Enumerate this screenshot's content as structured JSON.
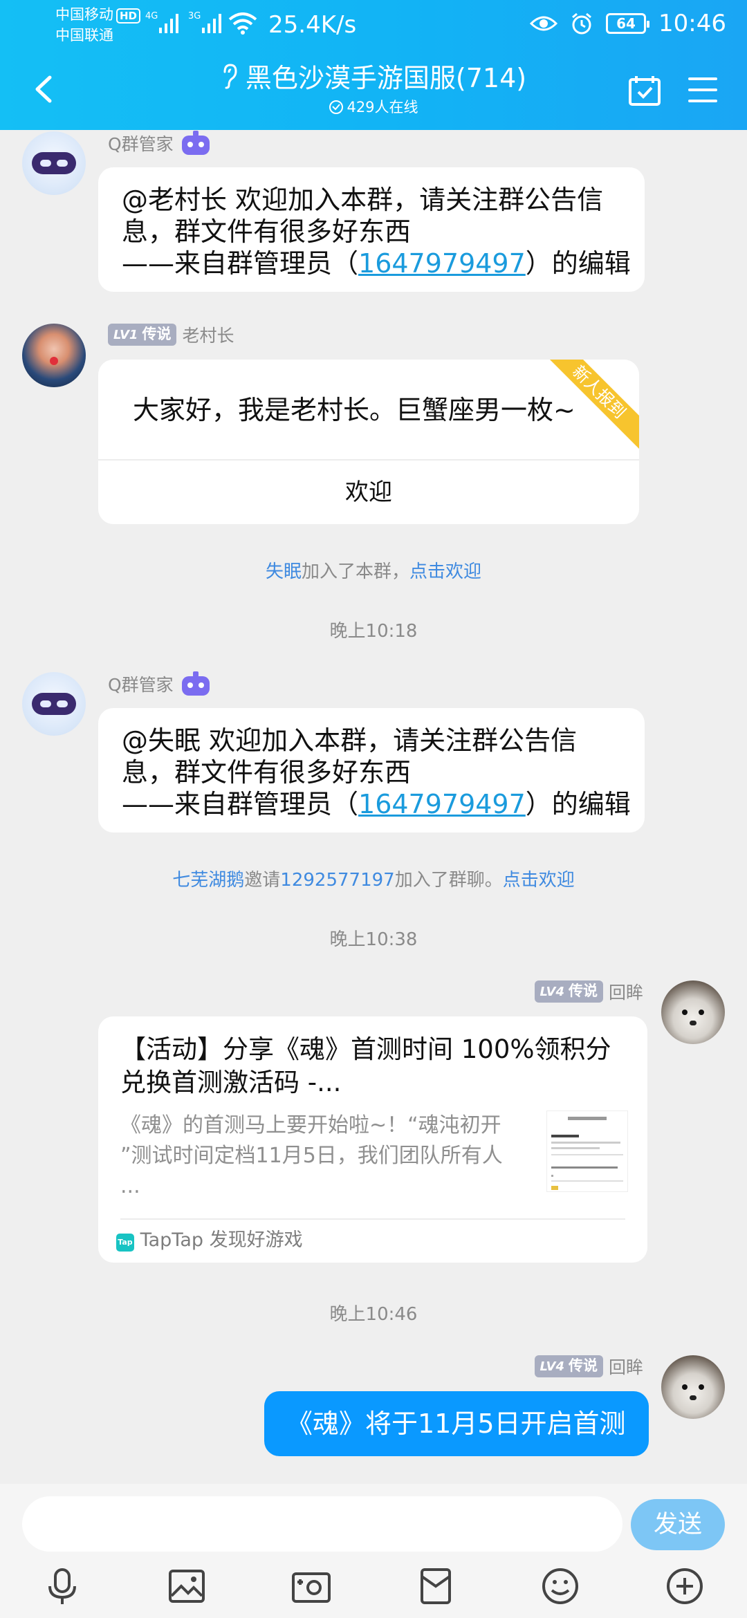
{
  "status_bar": {
    "carrier1": "中国移动",
    "hd": "HD",
    "carrier2": "中国联通",
    "net1": "4G",
    "net2": "3G",
    "speed": "25.4K/s",
    "battery": "64",
    "time": "10:46"
  },
  "header": {
    "title": "黑色沙漠手游国服(714)",
    "online": "429人在线"
  },
  "messages": {
    "m1": {
      "sender": "Q群管家",
      "line1": "@老村长 欢迎加入本群，请关注群公告信",
      "line2": "息，群文件有很多好东西",
      "line3_pre": "——来自群管理员（",
      "line3_link": "1647979497",
      "line3_post": "）的编辑"
    },
    "m2": {
      "level": "LV1",
      "title": "传说",
      "sender": "老村长",
      "text": "大家好，我是老村长。巨蟹座男一枚~",
      "ribbon": "新人报到",
      "action": "欢迎"
    },
    "sys1": {
      "name": "失眠",
      "text": "加入了本群，",
      "action": "点击欢迎"
    },
    "time1": "晚上10:18",
    "m3": {
      "sender": "Q群管家",
      "line1": "@失眠 欢迎加入本群，请关注群公告信",
      "line2": "息，群文件有很多好东西",
      "line3_pre": "——来自群管理员（",
      "line3_link": "1647979497",
      "line3_post": "）的编辑"
    },
    "sys2": {
      "inviter": "七芜湖鹅",
      "verb": "邀请",
      "invitee": "1292577197",
      "text": "加入了群聊。",
      "action": "点击欢迎"
    },
    "time2": "晚上10:38",
    "m4": {
      "level": "LV4",
      "title": "传说",
      "sender": "回眸",
      "card_title1": "【活动】分享《魂》首测时间 100%领积分",
      "card_title2": "兑换首测激活码 -...",
      "desc1": "《魂》的首测马上要开始啦~！“魂沌初开",
      "desc2": "”测试时间定档11月5日，我们团队所有人",
      "desc3": "...",
      "source_icon": "Tap",
      "source": "TapTap 发现好游戏"
    },
    "time3": "晚上10:46",
    "m5": {
      "level": "LV4",
      "title": "传说",
      "sender": "回眸",
      "text": "《魂》将于11月5日开启首测"
    }
  },
  "input_bar": {
    "send": "发送"
  }
}
